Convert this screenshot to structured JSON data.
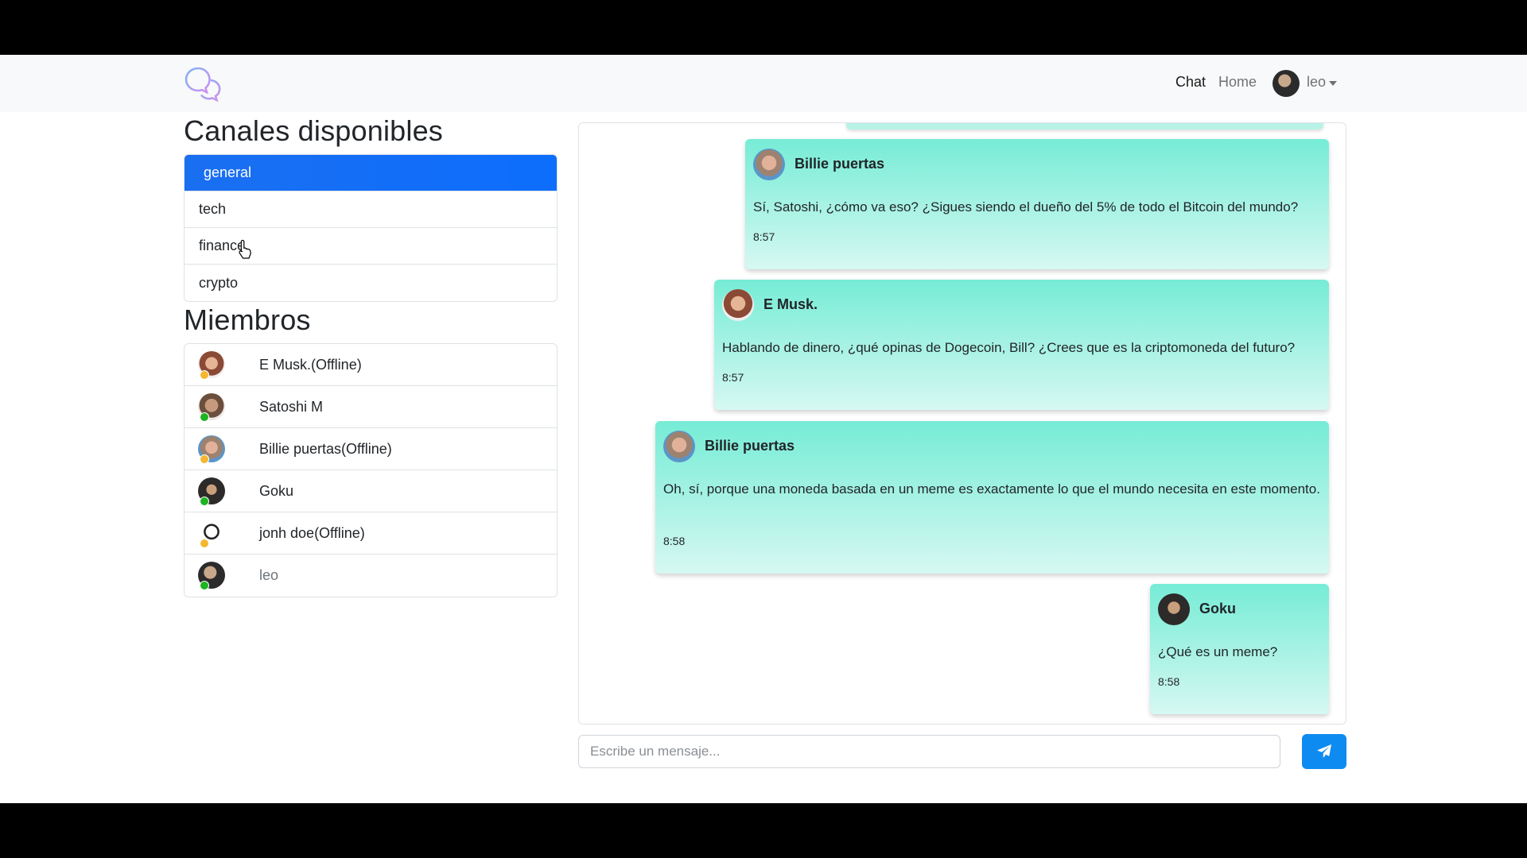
{
  "navbar": {
    "links": [
      {
        "label": "Chat"
      },
      {
        "label": "Home"
      }
    ],
    "user": {
      "name": "leo"
    }
  },
  "channels": {
    "title": "Canales disponibles",
    "items": [
      {
        "label": "general",
        "active": true
      },
      {
        "label": "tech"
      },
      {
        "label": "finance"
      },
      {
        "label": "crypto"
      }
    ]
  },
  "members": {
    "title": "Miembros",
    "items": [
      {
        "name": "E Musk.(Offline)",
        "status": "offline"
      },
      {
        "name": "Satoshi M",
        "status": "online"
      },
      {
        "name": "Billie puertas(Offline)",
        "status": "offline"
      },
      {
        "name": "Goku",
        "status": "online"
      },
      {
        "name": "jonh doe(Offline)",
        "status": "offline"
      },
      {
        "name": "leo",
        "status": "online"
      }
    ]
  },
  "messages": [
    {
      "author": "Billie puertas",
      "text": "Sí, Satoshi, ¿cómo va eso? ¿Sigues siendo el dueño del 5% de todo el Bitcoin del mundo?",
      "time": "8:57"
    },
    {
      "author": "E Musk.",
      "text": "Hablando de dinero, ¿qué opinas de Dogecoin, Bill? ¿Crees que es la criptomoneda del futuro?",
      "time": "8:57"
    },
    {
      "author": "Billie puertas",
      "text": "Oh, sí, porque una moneda basada en un meme es exactamente lo que el mundo necesita en este momento.",
      "time": "8:58"
    },
    {
      "author": "Goku",
      "text": "¿Qué es un meme?",
      "time": "8:58"
    }
  ],
  "composer": {
    "placeholder": "Escribe un mensaje..."
  },
  "colors": {
    "accent": "#0d6efd",
    "send_button": "#0d8bf0",
    "message_bg_top": "#76ecd6",
    "message_bg_bottom": "#d6f8f2",
    "online": "#1db322",
    "offline": "#f5b731"
  },
  "icons": {
    "logo": "chat-bubbles-icon",
    "send": "paper-plane-icon",
    "caret": "caret-down-icon"
  }
}
